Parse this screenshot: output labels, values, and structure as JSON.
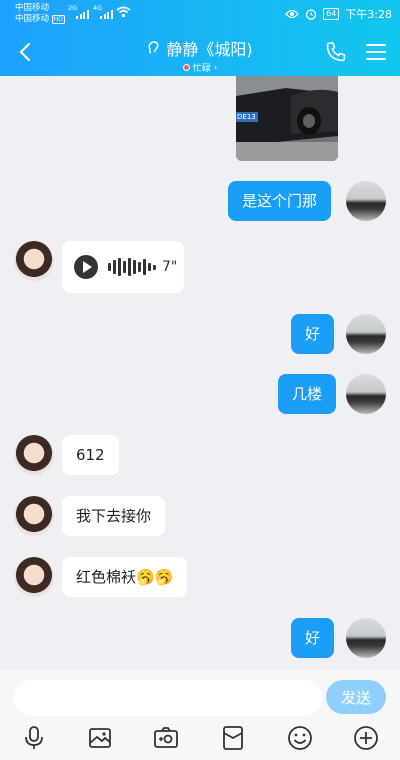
{
  "status_bar": {
    "carrier1": "中国移动",
    "carrier2": "中国移动",
    "hd_badge": "HD",
    "net_label": "4G",
    "net_label2": "2G",
    "battery": "64",
    "time": "下午3:28"
  },
  "header": {
    "title": "静静《城阳)",
    "status": "忙碌",
    "status_arrow": "›"
  },
  "messages": [
    {
      "dir": "out",
      "text": "是这个门那"
    },
    {
      "dir": "in",
      "type": "voice",
      "duration": "7\""
    },
    {
      "dir": "out",
      "text": "好"
    },
    {
      "dir": "out",
      "text": "几楼"
    },
    {
      "dir": "in",
      "text": "612"
    },
    {
      "dir": "in",
      "text": "我下去接你"
    },
    {
      "dir": "in",
      "text": "红色棉袄🥱🥱"
    },
    {
      "dir": "out",
      "text": "好"
    }
  ],
  "photo": {
    "plate_text": "DE13"
  },
  "input": {
    "placeholder": "",
    "send_label": "发送"
  },
  "toolbar": [
    "mic-icon",
    "picture-icon",
    "camera-icon",
    "red-packet-icon",
    "emoji-icon",
    "plus-icon"
  ],
  "colors": {
    "header_start": "#1ea0ff",
    "header_end": "#12c6ee",
    "bubble_out": "#1a9df5",
    "send_disabled": "#8ed0fb"
  }
}
